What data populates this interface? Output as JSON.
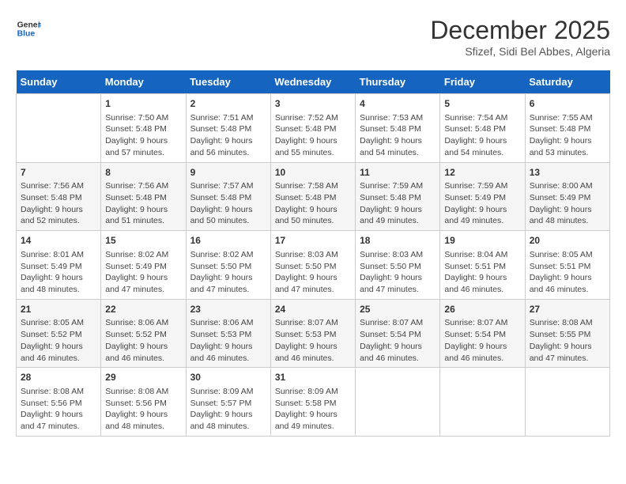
{
  "logo": {
    "line1": "General",
    "line2": "Blue"
  },
  "header": {
    "month": "December 2025",
    "location": "Sfizef, Sidi Bel Abbes, Algeria"
  },
  "weekdays": [
    "Sunday",
    "Monday",
    "Tuesday",
    "Wednesday",
    "Thursday",
    "Friday",
    "Saturday"
  ],
  "weeks": [
    [
      {
        "day": "",
        "content": ""
      },
      {
        "day": "1",
        "content": "Sunrise: 7:50 AM\nSunset: 5:48 PM\nDaylight: 9 hours\nand 57 minutes."
      },
      {
        "day": "2",
        "content": "Sunrise: 7:51 AM\nSunset: 5:48 PM\nDaylight: 9 hours\nand 56 minutes."
      },
      {
        "day": "3",
        "content": "Sunrise: 7:52 AM\nSunset: 5:48 PM\nDaylight: 9 hours\nand 55 minutes."
      },
      {
        "day": "4",
        "content": "Sunrise: 7:53 AM\nSunset: 5:48 PM\nDaylight: 9 hours\nand 54 minutes."
      },
      {
        "day": "5",
        "content": "Sunrise: 7:54 AM\nSunset: 5:48 PM\nDaylight: 9 hours\nand 54 minutes."
      },
      {
        "day": "6",
        "content": "Sunrise: 7:55 AM\nSunset: 5:48 PM\nDaylight: 9 hours\nand 53 minutes."
      }
    ],
    [
      {
        "day": "7",
        "content": "Sunrise: 7:56 AM\nSunset: 5:48 PM\nDaylight: 9 hours\nand 52 minutes."
      },
      {
        "day": "8",
        "content": "Sunrise: 7:56 AM\nSunset: 5:48 PM\nDaylight: 9 hours\nand 51 minutes."
      },
      {
        "day": "9",
        "content": "Sunrise: 7:57 AM\nSunset: 5:48 PM\nDaylight: 9 hours\nand 50 minutes."
      },
      {
        "day": "10",
        "content": "Sunrise: 7:58 AM\nSunset: 5:48 PM\nDaylight: 9 hours\nand 50 minutes."
      },
      {
        "day": "11",
        "content": "Sunrise: 7:59 AM\nSunset: 5:48 PM\nDaylight: 9 hours\nand 49 minutes."
      },
      {
        "day": "12",
        "content": "Sunrise: 7:59 AM\nSunset: 5:49 PM\nDaylight: 9 hours\nand 49 minutes."
      },
      {
        "day": "13",
        "content": "Sunrise: 8:00 AM\nSunset: 5:49 PM\nDaylight: 9 hours\nand 48 minutes."
      }
    ],
    [
      {
        "day": "14",
        "content": "Sunrise: 8:01 AM\nSunset: 5:49 PM\nDaylight: 9 hours\nand 48 minutes."
      },
      {
        "day": "15",
        "content": "Sunrise: 8:02 AM\nSunset: 5:49 PM\nDaylight: 9 hours\nand 47 minutes."
      },
      {
        "day": "16",
        "content": "Sunrise: 8:02 AM\nSunset: 5:50 PM\nDaylight: 9 hours\nand 47 minutes."
      },
      {
        "day": "17",
        "content": "Sunrise: 8:03 AM\nSunset: 5:50 PM\nDaylight: 9 hours\nand 47 minutes."
      },
      {
        "day": "18",
        "content": "Sunrise: 8:03 AM\nSunset: 5:50 PM\nDaylight: 9 hours\nand 47 minutes."
      },
      {
        "day": "19",
        "content": "Sunrise: 8:04 AM\nSunset: 5:51 PM\nDaylight: 9 hours\nand 46 minutes."
      },
      {
        "day": "20",
        "content": "Sunrise: 8:05 AM\nSunset: 5:51 PM\nDaylight: 9 hours\nand 46 minutes."
      }
    ],
    [
      {
        "day": "21",
        "content": "Sunrise: 8:05 AM\nSunset: 5:52 PM\nDaylight: 9 hours\nand 46 minutes."
      },
      {
        "day": "22",
        "content": "Sunrise: 8:06 AM\nSunset: 5:52 PM\nDaylight: 9 hours\nand 46 minutes."
      },
      {
        "day": "23",
        "content": "Sunrise: 8:06 AM\nSunset: 5:53 PM\nDaylight: 9 hours\nand 46 minutes."
      },
      {
        "day": "24",
        "content": "Sunrise: 8:07 AM\nSunset: 5:53 PM\nDaylight: 9 hours\nand 46 minutes."
      },
      {
        "day": "25",
        "content": "Sunrise: 8:07 AM\nSunset: 5:54 PM\nDaylight: 9 hours\nand 46 minutes."
      },
      {
        "day": "26",
        "content": "Sunrise: 8:07 AM\nSunset: 5:54 PM\nDaylight: 9 hours\nand 46 minutes."
      },
      {
        "day": "27",
        "content": "Sunrise: 8:08 AM\nSunset: 5:55 PM\nDaylight: 9 hours\nand 47 minutes."
      }
    ],
    [
      {
        "day": "28",
        "content": "Sunrise: 8:08 AM\nSunset: 5:56 PM\nDaylight: 9 hours\nand 47 minutes."
      },
      {
        "day": "29",
        "content": "Sunrise: 8:08 AM\nSunset: 5:56 PM\nDaylight: 9 hours\nand 48 minutes."
      },
      {
        "day": "30",
        "content": "Sunrise: 8:09 AM\nSunset: 5:57 PM\nDaylight: 9 hours\nand 48 minutes."
      },
      {
        "day": "31",
        "content": "Sunrise: 8:09 AM\nSunset: 5:58 PM\nDaylight: 9 hours\nand 49 minutes."
      },
      {
        "day": "",
        "content": ""
      },
      {
        "day": "",
        "content": ""
      },
      {
        "day": "",
        "content": ""
      }
    ]
  ]
}
